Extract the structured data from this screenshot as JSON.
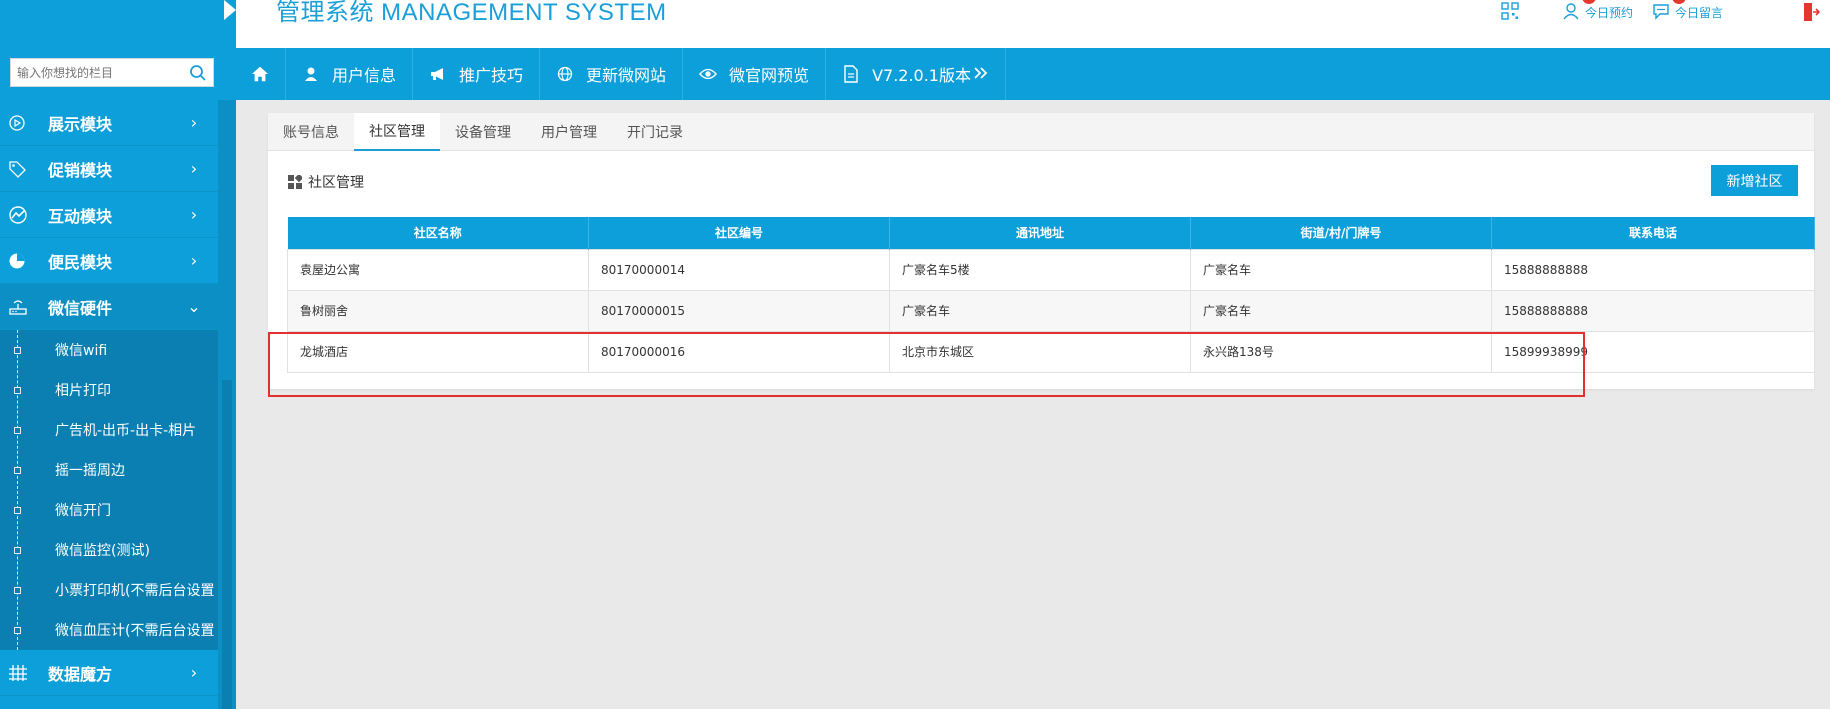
{
  "header": {
    "title": "管理系统 MANAGEMENT SYSTEM",
    "tools": [
      {
        "label": "今日预约",
        "icon": "user-icon"
      },
      {
        "label": "今日留言",
        "icon": "chat-icon"
      },
      {
        "label": "",
        "icon": "qrcode-icon"
      },
      {
        "label": "",
        "icon": "logout-icon"
      }
    ]
  },
  "sidebar": {
    "search_placeholder": "输入你想找的栏目",
    "menu": [
      {
        "label": "展示模块",
        "icon": "play-circle-icon"
      },
      {
        "label": "促销模块",
        "icon": "tag-icon"
      },
      {
        "label": "互动模块",
        "icon": "activity-icon"
      },
      {
        "label": "便民模块",
        "icon": "pie-chart-icon"
      },
      {
        "label": "微信硬件",
        "icon": "router-icon",
        "expanded": true
      },
      {
        "label": "数据魔方",
        "icon": "grid-icon"
      }
    ],
    "submenu": [
      "微信wifi",
      "相片打印",
      "广告机-出币-出卡-相片",
      "摇一摇周边",
      "微信开门",
      "微信监控(测试)",
      "小票打印机(不需后台设置",
      "微信血压计(不需后台设置"
    ]
  },
  "navbar": {
    "items": [
      {
        "label": "",
        "icon": "home-icon"
      },
      {
        "label": "用户信息",
        "icon": "user-icon"
      },
      {
        "label": "推广技巧",
        "icon": "megaphone-icon"
      },
      {
        "label": "更新微网站",
        "icon": "globe-icon"
      },
      {
        "label": "微官网预览",
        "icon": "eye-icon"
      },
      {
        "label": "V7.2.0.1版本",
        "icon": "document-icon"
      }
    ]
  },
  "tabs": [
    "账号信息",
    "社区管理",
    "设备管理",
    "用户管理",
    "开门记录"
  ],
  "active_tab": 1,
  "section": {
    "title": "社区管理",
    "add_button": "新增社区"
  },
  "table": {
    "columns": [
      "社区名称",
      "社区编号",
      "通讯地址",
      "街道/村/门牌号",
      "联系电话"
    ],
    "rows": [
      [
        "袁屋边公寓",
        "80170000014",
        "广豪名车5楼",
        "广豪名车",
        "15888888888"
      ],
      [
        "鲁树丽舍",
        "80170000015",
        "广豪名车",
        "广豪名车",
        "15888888888"
      ],
      [
        "龙城酒店",
        "80170000016",
        "北京市东城区",
        "永兴路138号",
        "15899938999"
      ]
    ]
  },
  "colors": {
    "primary": "#0d9fd9",
    "highlight": "#e0312f",
    "badge": "#e6372e"
  }
}
